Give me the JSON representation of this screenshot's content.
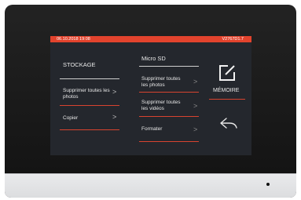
{
  "status": {
    "datetime": "06.10.2018  19:08",
    "version": "V2767D1.7"
  },
  "left_menu": {
    "title": "STOCKAGE",
    "items": [
      {
        "label": "Supprimer toutes les photos"
      },
      {
        "label": "Copier"
      }
    ]
  },
  "middle_menu": {
    "title": "Micro SD",
    "items": [
      {
        "label": "Supprimer toutes les photos"
      },
      {
        "label": "Supprimer toutes les vidéos"
      },
      {
        "label": "Formater"
      }
    ]
  },
  "right_panel": {
    "memory_label": "MÉMOIRE",
    "memory_icon": "edit-square-icon",
    "back_icon": "back-arrow-icon"
  },
  "colors": {
    "accent": "#e2432d",
    "screen_bg": "#24272d",
    "bezel": "#1a1a1a"
  }
}
